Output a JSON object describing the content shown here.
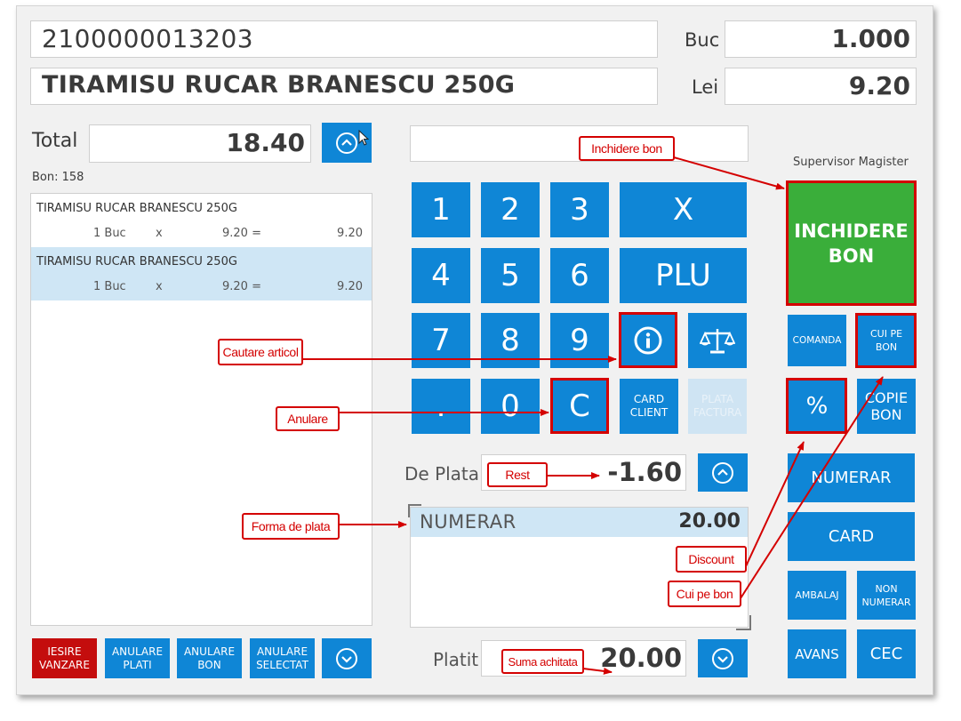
{
  "header": {
    "barcode": "2100000013203",
    "product_name": "TIRAMISU RUCAR BRANESCU 250G",
    "qty_label": "Buc",
    "qty_value": "1.000",
    "price_label": "Lei",
    "price_value": "9.20"
  },
  "totals": {
    "total_label": "Total",
    "total_value": "18.40",
    "bon_label": "Bon: 158"
  },
  "receipt_items": [
    {
      "name": "TIRAMISU RUCAR BRANESCU 250G",
      "qty": "1 Buc",
      "x": "x",
      "price": "9.20 =",
      "amount": "9.20",
      "selected": false
    },
    {
      "name": "TIRAMISU RUCAR BRANESCU 250G",
      "qty": "1 Buc",
      "x": "x",
      "price": "9.20 =",
      "amount": "9.20",
      "selected": true
    }
  ],
  "bottom_buttons": {
    "iesire": "IESIRE VANZARE",
    "anulare_plati": "ANULARE PLATI",
    "anulare_bon": "ANULARE BON",
    "anulare_selectat": "ANULARE SELECTAT"
  },
  "keypad": {
    "k1": "1",
    "k2": "2",
    "k3": "3",
    "multiply": "X",
    "k4": "4",
    "k5": "5",
    "k6": "6",
    "plu": "PLU",
    "k7": "7",
    "k8": "8",
    "k9": "9",
    "dot": ".",
    "k0": "0",
    "clear": "C",
    "card_client": "CARD CLIENT",
    "plata_factura": "PLATA FACTURA"
  },
  "payment": {
    "de_plata_label": "De Plata",
    "de_plata_value": "-1.60",
    "method": "NUMERAR",
    "method_amount": "20.00",
    "platit_label": "Platit",
    "platit_value": "20.00"
  },
  "right_panel": {
    "supervisor": "Supervisor Magister",
    "inchidere_bon": "INCHIDERE BON",
    "comanda": "COMANDA",
    "cui_pe_bon": "CUI PE BON",
    "percent": "%",
    "copie_bon": "COPIE BON",
    "numerar": "NUMERAR",
    "card": "CARD",
    "ambalaj": "AMBALAJ",
    "non_numerar": "NON NUMERAR",
    "avans": "AVANS",
    "cec": "CEC"
  },
  "annotations": {
    "inchidere_bon": "Inchidere bon",
    "cautare_articol": "Cautare articol",
    "anulare": "Anulare",
    "rest": "Rest",
    "forma_de_plata": "Forma de plata",
    "discount": "Discount",
    "cui_pe_bon": "Cui pe bon",
    "suma_achitata": "Suma achitata"
  },
  "colors": {
    "button_blue": "#0f86d6",
    "close_green": "#3aae3a",
    "exit_red": "#c40d0d",
    "disabled_blue": "#cfe4f3",
    "annotation_red": "#d40000",
    "selected_row": "#cfe6f5"
  }
}
